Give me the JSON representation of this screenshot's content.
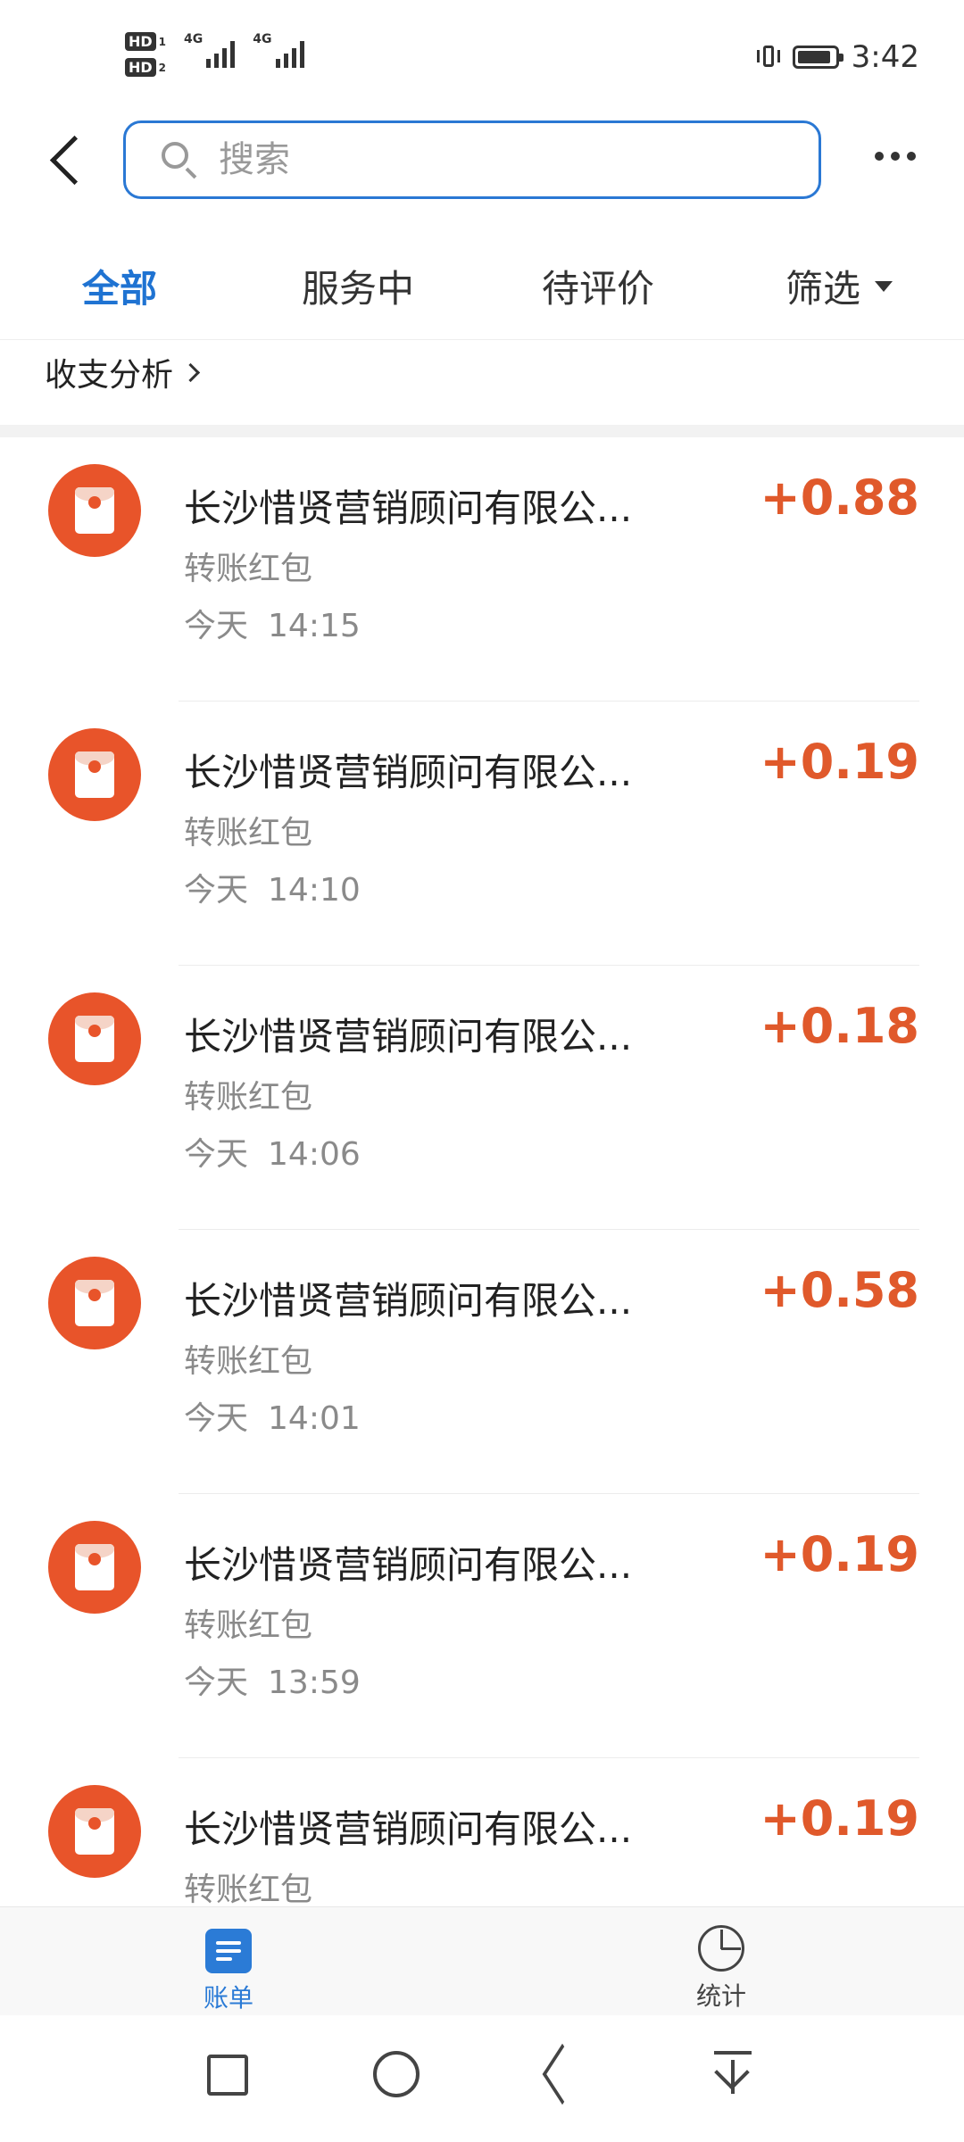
{
  "status_bar": {
    "sim1": {
      "hd": "HD",
      "slot": "1",
      "network": "4G"
    },
    "sim2": {
      "hd": "HD",
      "slot": "2",
      "network": "4G"
    },
    "time": "3:42",
    "battery_level": 0.9
  },
  "header": {
    "search_placeholder": "搜索"
  },
  "tabs": [
    {
      "label": "全部",
      "active": true
    },
    {
      "label": "服务中",
      "active": false
    },
    {
      "label": "待评价",
      "active": false
    },
    {
      "label": "筛选",
      "active": false
    }
  ],
  "analysis": {
    "label": "收支分析"
  },
  "transactions": [
    {
      "name": "长沙惜贤营销顾问有限公...",
      "type": "转账红包",
      "day": "今天",
      "time": "14:15",
      "amount": "+0.88"
    },
    {
      "name": "长沙惜贤营销顾问有限公...",
      "type": "转账红包",
      "day": "今天",
      "time": "14:10",
      "amount": "+0.19"
    },
    {
      "name": "长沙惜贤营销顾问有限公...",
      "type": "转账红包",
      "day": "今天",
      "time": "14:06",
      "amount": "+0.18"
    },
    {
      "name": "长沙惜贤营销顾问有限公...",
      "type": "转账红包",
      "day": "今天",
      "time": "14:01",
      "amount": "+0.58"
    },
    {
      "name": "长沙惜贤营销顾问有限公...",
      "type": "转账红包",
      "day": "今天",
      "time": "13:59",
      "amount": "+0.19"
    },
    {
      "name": "长沙惜贤营销顾问有限公...",
      "type": "转账红包",
      "day": "",
      "time": "",
      "amount": "+0.19"
    }
  ],
  "bottom_nav": {
    "bill": {
      "label": "账单",
      "active": true
    },
    "stats": {
      "label": "统计",
      "active": false
    }
  },
  "colors": {
    "accent": "#1f73d2",
    "amount": "#e0592b",
    "icon_bg": "#e8542a"
  }
}
